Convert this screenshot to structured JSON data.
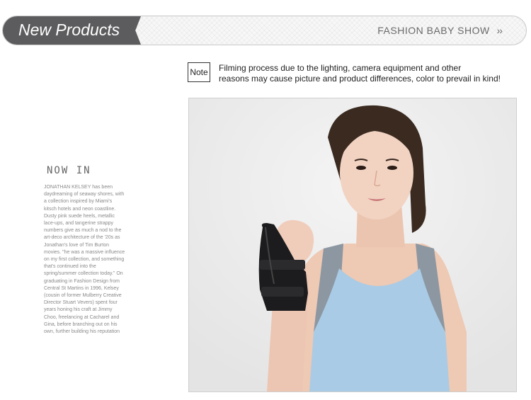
{
  "banner": {
    "title": "New Products",
    "subtitle": "FASHION BABY SHOW",
    "chevron": "››"
  },
  "note": {
    "label": "Note",
    "line1": "Filming process due to the lighting, camera equipment and other",
    "line2": "reasons may cause picture and product differences, color to prevail in kind!"
  },
  "side": {
    "heading": "NOW IN",
    "lines": [
      "JONATHAN KELSEY has been",
      "daydreaming of seaway shores, with",
      "a collection inspired by Miami's",
      "kitsch hotels and neon coastline.",
      "Dusty pink suede heels, metallic",
      "lace-ups, and tangerine strappy",
      "numbers give as much a nod to the",
      "art-deco architecture of the '20s as",
      "Jonathan's love of Tim Burton",
      "movies. \"he was a massive influence",
      "on my first collection, and something",
      "that's continued into the",
      "spring/summer collection today.\" On",
      "graduating in Fashion Design from",
      "Central St Martins in 1996, Kelsey",
      "(cousin of former Mulberry Creative",
      "Director Stuart Vevers) spent four",
      "years honing his craft at Jimmy",
      "Choo, freelancing at Cacharel and",
      "Gina, before branching out on his",
      "own, further building his reputation"
    ]
  }
}
